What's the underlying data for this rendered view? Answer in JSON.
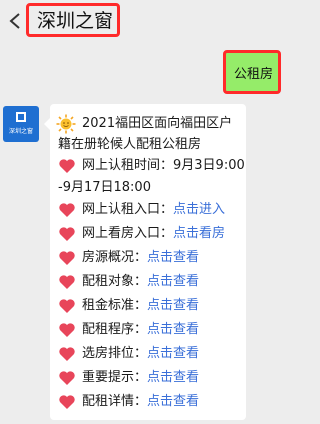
{
  "header": {
    "title": "深圳之窗"
  },
  "user_message": {
    "text": "公租房"
  },
  "bot": {
    "avatar_label": "深圳之窗"
  },
  "reply": {
    "intro_line1": "2021福田区面向福田区户",
    "intro_line2": "籍在册轮候人配租公租房",
    "time_line1": "网上认租时间：9月3日9:00",
    "time_line2": "-9月17日18:00",
    "items": [
      {
        "label": "网上认租入口：",
        "link": "点击进入"
      },
      {
        "label": "网上看房入口：",
        "link": "点击看房"
      },
      {
        "label": "房源概况：",
        "link": "点击查看"
      },
      {
        "label": "配租对象：",
        "link": "点击查看"
      },
      {
        "label": "租金标准：",
        "link": "点击查看"
      },
      {
        "label": "配租程序：",
        "link": "点击查看"
      },
      {
        "label": "选房排位：",
        "link": "点击查看"
      },
      {
        "label": "重要提示：",
        "link": "点击查看"
      },
      {
        "label": "配租详情：",
        "link": "点击查看"
      }
    ]
  },
  "colors": {
    "link": "#3a6fd8",
    "highlight_border": "#ff2a2a",
    "user_bubble": "#95ec69",
    "heart": "#e8455a"
  }
}
